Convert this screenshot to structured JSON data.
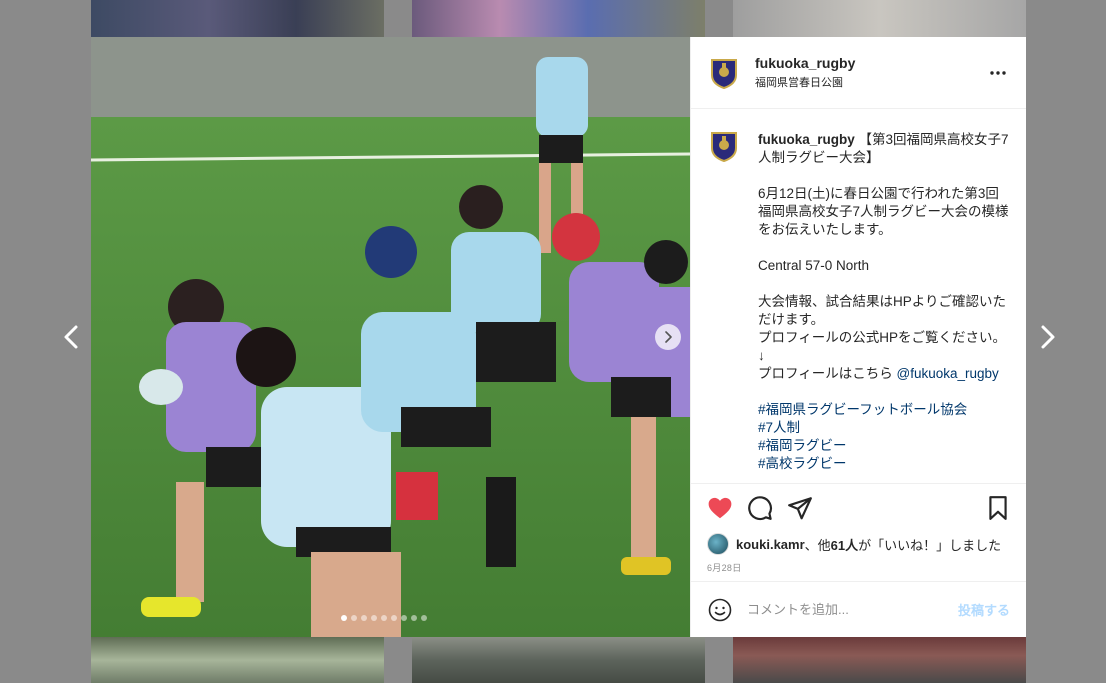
{
  "post": {
    "username": "fukuoka_rugby",
    "location": "福岡県営春日公園",
    "caption_title": "【第3回福岡県高校女子7人制ラグビー大会】",
    "caption_lines": [
      "6月12日(土)に春日公園で行われた第3回福岡県高校女子7人制ラグビー大会の模様をお伝えいたします。",
      "Central 57-0 North",
      "大会情報、試合結果はHPよりご確認いただけます。",
      "プロフィールの公式HPをご覧ください。",
      "↓",
      "プロフィールはこちら "
    ],
    "mention": "@fukuoka_rugby",
    "hashtags": [
      "#福岡県ラグビーフットボール協会",
      "#7人制",
      "#福岡ラグビー",
      "#高校ラグビー"
    ],
    "liker": "kouki.kamr",
    "likes_conj": "、他",
    "likes_count": "61人",
    "likes_tail": "が「いいね！」しました",
    "date": "6月28日",
    "comment_placeholder": "コメントを追加...",
    "post_button": "投稿する",
    "carousel": {
      "total": 9,
      "current": 1
    }
  },
  "colors": {
    "like_red": "#ed4956",
    "post_button_disabled": "#b3dbff",
    "link": "#00376b"
  },
  "icons": [
    "chevron-left-icon",
    "chevron-right-icon",
    "more-icon",
    "heart-icon",
    "comment-icon",
    "share-icon",
    "bookmark-icon",
    "emoji-icon"
  ]
}
